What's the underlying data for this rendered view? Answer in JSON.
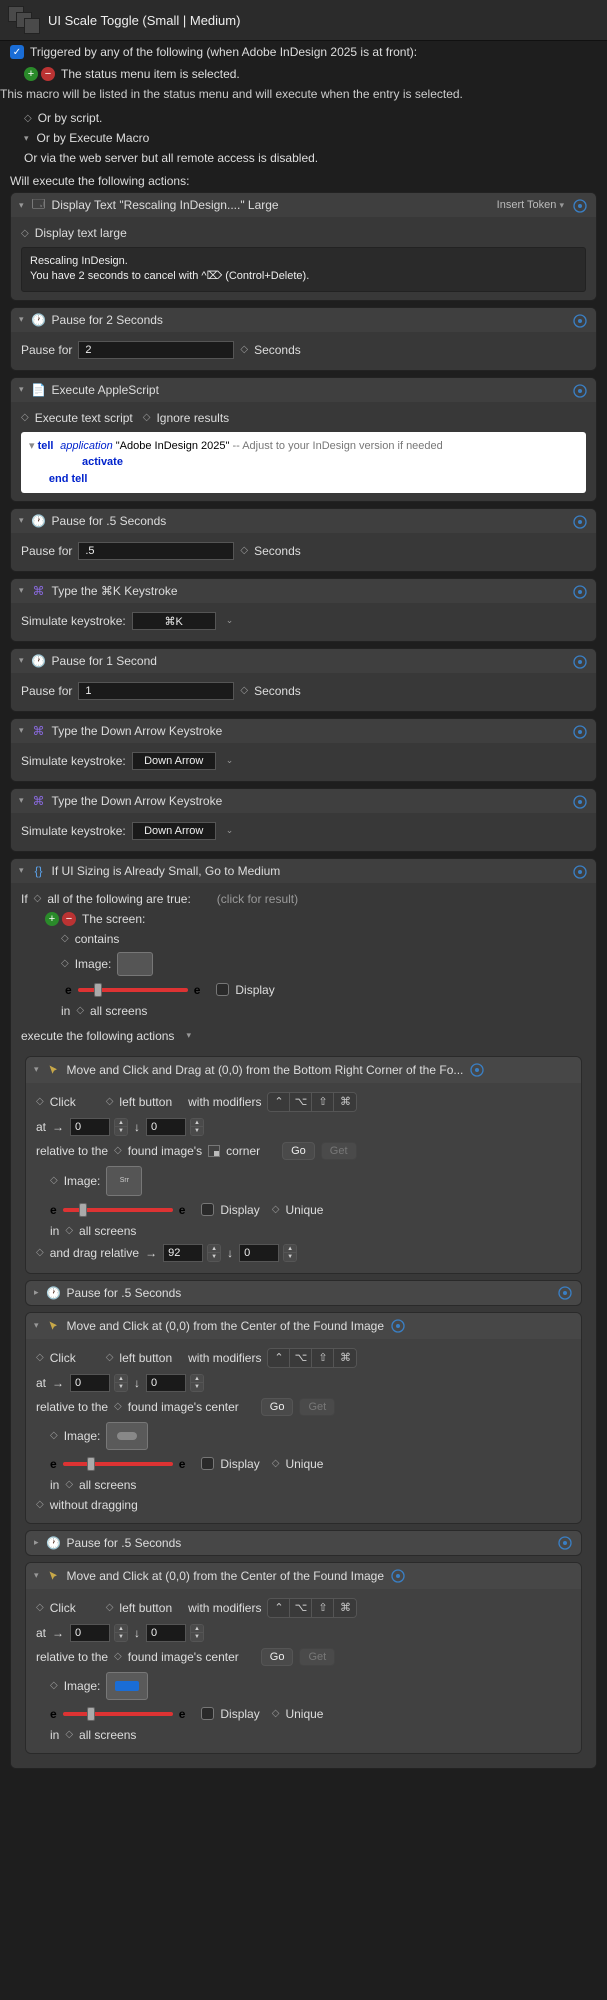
{
  "header": {
    "title": "UI Scale Toggle (Small | Medium)"
  },
  "trigger": {
    "label": "Triggered by any of the following (when Adobe InDesign 2025 is at front):",
    "status_selected": "The status menu item is selected.",
    "status_desc": "This macro will be listed in the status menu and will execute when the entry is selected.",
    "or_script": "Or by script.",
    "or_execute": "Or by Execute Macro",
    "or_web": "Or via the web server but all remote access is disabled."
  },
  "will_execute": "Will execute the following actions:",
  "a1": {
    "title": "Display Text \"Rescaling InDesign....\" Large",
    "opt": "Display text large",
    "insert_token": "Insert Token",
    "body_l1": "Rescaling InDesign.",
    "body_l2": "You have 2 seconds to cancel with ^⌦ (Control+Delete)."
  },
  "a2": {
    "title": "Pause for 2 Seconds",
    "label": "Pause for",
    "value": "2",
    "unit": "Seconds"
  },
  "a3": {
    "title": "Execute AppleScript",
    "opt1": "Execute text script",
    "opt2": "Ignore results",
    "kw_tell": "tell",
    "kw_app": "application",
    "str_app": " \"Adobe InDesign 2025\" ",
    "comment": "-- Adjust to your InDesign version if needed",
    "activate": "activate",
    "end": "end tell"
  },
  "a4": {
    "title": "Pause for .5 Seconds",
    "label": "Pause for",
    "value": ".5",
    "unit": "Seconds"
  },
  "a5": {
    "title": "Type the ⌘K Keystroke",
    "label": "Simulate keystroke:",
    "key": "⌘K"
  },
  "a6": {
    "title": "Pause for 1 Second",
    "label": "Pause for",
    "value": "1",
    "unit": "Seconds"
  },
  "a7": {
    "title": "Type the Down Arrow Keystroke",
    "label": "Simulate keystroke:",
    "key": "Down Arrow"
  },
  "a8": {
    "title": "Type the Down Arrow Keystroke",
    "label": "Simulate keystroke:",
    "key": "Down Arrow"
  },
  "a9": {
    "title": "If UI Sizing is Already Small, Go to Medium",
    "if_label": "If",
    "cond_mode": "all of the following are true:",
    "click_result": "(click for result)",
    "screen_label": "The screen:",
    "contains": "contains",
    "image_label": "Image:",
    "display": "Display",
    "in_label": "in",
    "all_screens": "all screens",
    "exec_label": "execute the following actions",
    "n1": {
      "title": "Move and Click and Drag at (0,0) from the Bottom Right Corner of the Fo...",
      "click": "Click",
      "btn": "left button",
      "with_mod": "with modifiers",
      "at": "at",
      "x": "0",
      "y": "0",
      "rel": "relative to the",
      "target": "found image's",
      "corner_suffix": "corner",
      "image": "Image:",
      "img_text": "Srr",
      "display": "Display",
      "unique": "Unique",
      "in": "in",
      "screens": "all screens",
      "drag": "and drag relative",
      "dx": "92",
      "dy": "0",
      "go": "Go",
      "get": "Get"
    },
    "n2": {
      "title": "Pause for .5 Seconds"
    },
    "n3": {
      "title": "Move and Click at (0,0) from the Center of the Found Image",
      "click": "Click",
      "btn": "left button",
      "with_mod": "with modifiers",
      "at": "at",
      "x": "0",
      "y": "0",
      "rel": "relative to the",
      "target": "found image's center",
      "image": "Image:",
      "display": "Display",
      "unique": "Unique",
      "in": "in",
      "screens": "all screens",
      "without": "without dragging",
      "go": "Go",
      "get": "Get"
    },
    "n4": {
      "title": "Pause for .5 Seconds"
    },
    "n5": {
      "title": "Move and Click at (0,0) from the Center of the Found Image",
      "click": "Click",
      "btn": "left button",
      "with_mod": "with modifiers",
      "at": "at",
      "x": "0",
      "y": "0",
      "rel": "relative to the",
      "target": "found image's center",
      "image": "Image:",
      "display": "Display",
      "unique": "Unique",
      "in": "in",
      "screens": "all screens",
      "go": "Go",
      "get": "Get"
    }
  }
}
